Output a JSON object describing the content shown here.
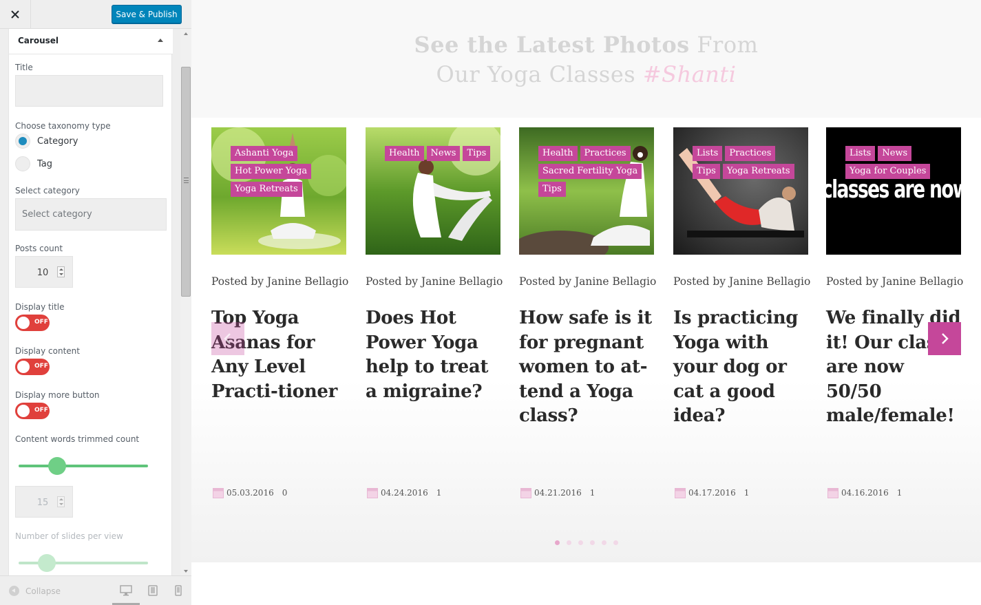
{
  "panel": {
    "save_label": "Save & Publish",
    "section_title": "Carousel",
    "title_label": "Title",
    "title_value": "",
    "taxonomy_label": "Choose taxonomy type",
    "taxonomy_options": [
      "Category",
      "Tag"
    ],
    "taxonomy_selected": "Category",
    "select_category_label": "Select category",
    "select_category_placeholder": "Select category",
    "posts_count_label": "Posts count",
    "posts_count_value": "10",
    "display_title_label": "Display title",
    "display_title_state": "OFF",
    "display_content_label": "Display content",
    "display_content_state": "OFF",
    "display_more_label": "Display more button",
    "display_more_state": "OFF",
    "words_trimmed_label": "Content words trimmed count",
    "words_trimmed_value": "15",
    "words_trimmed_slider_pct": 30,
    "slides_per_view_label": "Number of slides per view",
    "slides_per_view_slider_pct": 22,
    "collapse_label": "Collapse",
    "toggle_color": "#e0403c",
    "primary_color": "#0085ba"
  },
  "hero": {
    "line1_bold": "See the Latest Photos",
    "line1_rest": " From",
    "line2_plain": "Our Yoga Classes ",
    "line2_accent": "#Shanti"
  },
  "accent_color": "#c5479a",
  "cards": [
    {
      "tags": [
        "Ashanti Yoga",
        "Hot Power Yoga",
        "Yoga Retreats"
      ],
      "byline": "Posted by Janine Bellagio",
      "title": "Top Yoga Asanas for Any Level Practi-tioner",
      "date": "05.03.2016",
      "comments": "0"
    },
    {
      "tags": [
        "Health",
        "News",
        "Tips"
      ],
      "byline": "Posted by Janine Bellagio",
      "title": "Does Hot Power Yoga help to treat a migraine?",
      "date": "04.24.2016",
      "comments": "1"
    },
    {
      "tags": [
        "Health",
        "Practices",
        "Sacred Fertility Yoga",
        "Tips"
      ],
      "byline": "Posted by Janine Bellagio",
      "title": "How safe is it for pregnant women to at-tend a Yoga class?",
      "date": "04.21.2016",
      "comments": "1"
    },
    {
      "tags": [
        "Lists",
        "Practices",
        "Tips",
        "Yoga Retreats"
      ],
      "byline": "Posted by Janine Bellagio",
      "title": "Is practicing Yoga with your dog or cat a good idea?",
      "date": "04.17.2016",
      "comments": "1"
    },
    {
      "tags": [
        "Lists",
        "News",
        "Yoga for Couples"
      ],
      "byline": "Posted by Janine Bellagio",
      "title": "We finally did it! Our class are now 50/50 male/female!",
      "date": "04.16.2016",
      "comments": "1",
      "image_text": "classes are now"
    }
  ],
  "pagination": {
    "total": 6,
    "active": 0
  }
}
